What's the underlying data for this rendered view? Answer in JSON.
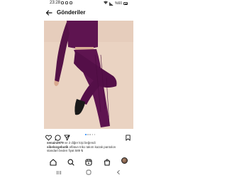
{
  "status_bar": {
    "time": "23:28",
    "battery": "%60"
  },
  "header": {
    "title": "Gönderiler"
  },
  "post": {
    "image_icon": "photo-woman-purple-knit-outfit",
    "carousel": {
      "count": 5,
      "active": 1
    },
    "likes": {
      "user": "senain2979",
      "rest": " ve 2 diğer kişi beğendi"
    },
    "caption": {
      "user": "sibelozgebutik",
      "text": " elfatun triko takım kazak pantolon",
      "more": "standart beden fiyat 589 ₺"
    }
  },
  "bottom_nav": {
    "items": [
      "home-icon",
      "search-icon",
      "reels-icon",
      "shop-icon",
      "profile-avatar"
    ]
  },
  "system_nav": {
    "items": [
      "recent-apps-icon",
      "home-circle-icon",
      "back-arrow-icon"
    ]
  },
  "colors": {
    "background": "#ffffff",
    "photo_bg": "#ead3c2",
    "outfit": "#5e1450",
    "carousel_active": "#2f8dff"
  }
}
